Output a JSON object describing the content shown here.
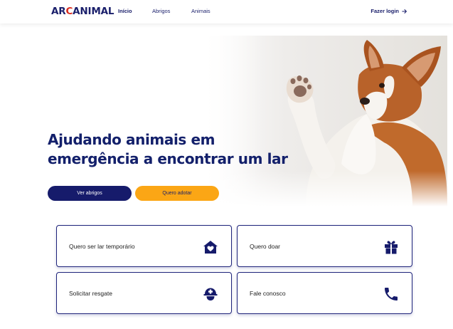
{
  "nav": {
    "logo_main": "ARCANIMAL",
    "logo_prefix": "AR",
    "logo_accent": "C",
    "logo_suffix": "ANIMAL",
    "links": [
      {
        "label": "Início",
        "active": true
      },
      {
        "label": "Abrigos",
        "active": false
      },
      {
        "label": "Animais",
        "active": false
      }
    ],
    "login_label": "Fazer login"
  },
  "hero": {
    "title_line1": "Ajudando animais em",
    "title_line2": "emergência a encontrar um lar",
    "btn_primary": "Ver abrigos",
    "btn_secondary": "Quero adotar"
  },
  "cards": [
    {
      "label": "Quero ser lar temporário",
      "icon": "house-heart-icon"
    },
    {
      "label": "Quero doar",
      "icon": "gift-icon"
    },
    {
      "label": "Solicitar resgate",
      "icon": "rescue-helmet-icon"
    },
    {
      "label": "Fale conosco",
      "icon": "phone-icon"
    }
  ],
  "colors": {
    "navy": "#161b6b",
    "orange": "#fba615",
    "logo_red": "#d92d20"
  }
}
